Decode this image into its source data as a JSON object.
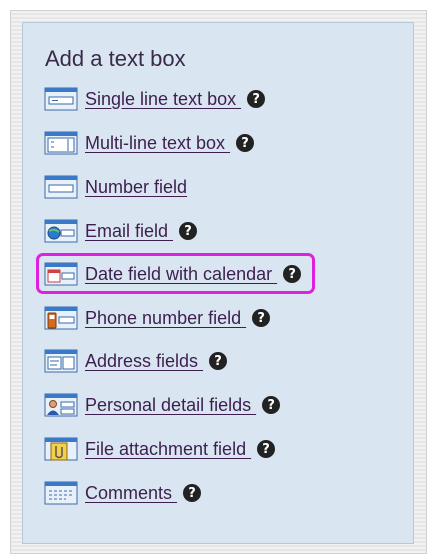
{
  "panel": {
    "title": "Add a text box",
    "accent_highlight_color": "#e020e0",
    "items": [
      {
        "label": "Single line text box ",
        "icon": "single-line-textbox-icon",
        "help": true
      },
      {
        "label": "Multi-line text box ",
        "icon": "multi-line-textbox-icon",
        "help": true
      },
      {
        "label": "Number field",
        "icon": "number-field-icon",
        "help": false
      },
      {
        "label": "Email field ",
        "icon": "email-field-icon",
        "help": true
      },
      {
        "label": "Date field with calendar ",
        "icon": "calendar-field-icon",
        "help": true,
        "highlighted": true
      },
      {
        "label": "Phone number field ",
        "icon": "phone-field-icon",
        "help": true
      },
      {
        "label": "Address fields ",
        "icon": "address-field-icon",
        "help": true
      },
      {
        "label": "Personal detail fields ",
        "icon": "personal-details-icon",
        "help": true
      },
      {
        "label": "File attachment field ",
        "icon": "file-attachment-icon",
        "help": true
      },
      {
        "label": "Comments ",
        "icon": "comments-icon",
        "help": true
      }
    ],
    "help_glyph": "?"
  }
}
